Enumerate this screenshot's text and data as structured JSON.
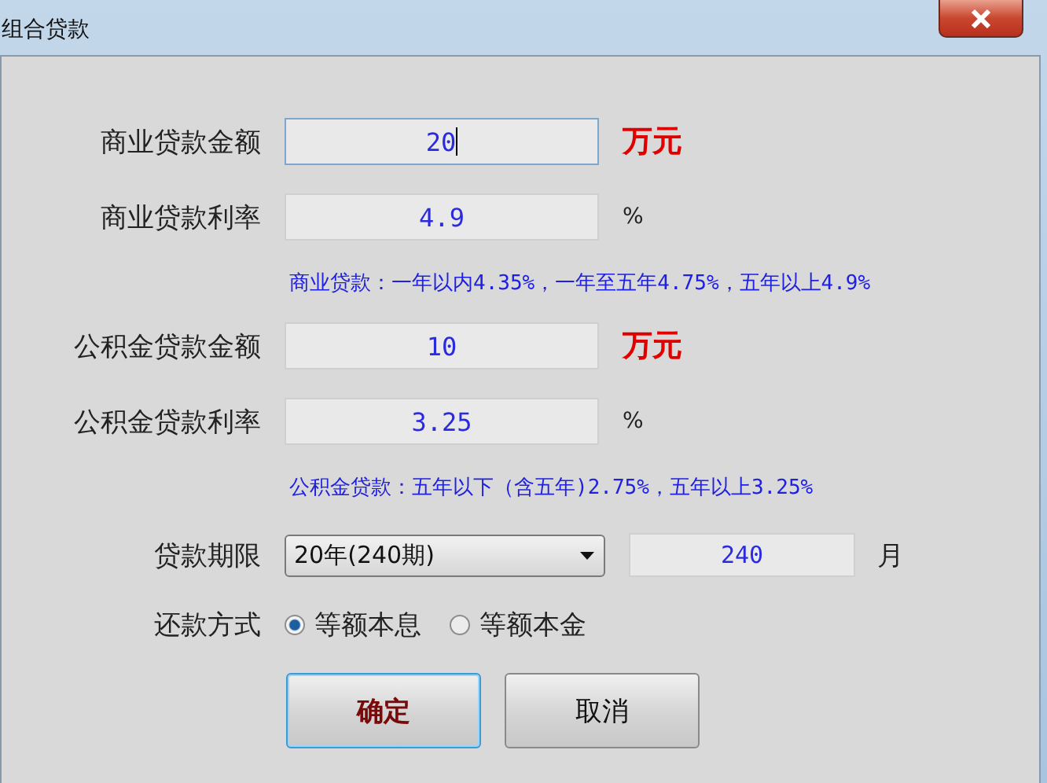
{
  "window": {
    "title": "组合贷款"
  },
  "sections": [
    {
      "fields": [
        {
          "kind": "amount",
          "label": "商业贷款金额",
          "value": "20",
          "unit": "万元",
          "focused": true
        },
        {
          "kind": "rate",
          "label": "商业贷款利率",
          "value": "4.9",
          "unit": "%",
          "focused": false
        }
      ],
      "hint": "商业贷款：一年以内4.35%，一年至五年4.75%，五年以上4.9%"
    },
    {
      "fields": [
        {
          "kind": "amount",
          "label": "公积金贷款金额",
          "value": "10",
          "unit": "万元",
          "focused": false
        },
        {
          "kind": "rate",
          "label": "公积金贷款利率",
          "value": "3.25",
          "unit": "%",
          "focused": false
        }
      ],
      "hint": "公积金贷款：五年以下（含五年)2.75%，五年以上3.25%"
    }
  ],
  "term": {
    "label": "贷款期限",
    "selected": "20年(240期)",
    "months": "240",
    "unit": "月"
  },
  "repayment": {
    "label": "还款方式",
    "options": [
      {
        "label": "等额本息",
        "selected": true
      },
      {
        "label": "等额本金",
        "selected": false
      }
    ]
  },
  "buttons": [
    {
      "label": "确定",
      "default": true
    },
    {
      "label": "取消",
      "default": false
    }
  ]
}
